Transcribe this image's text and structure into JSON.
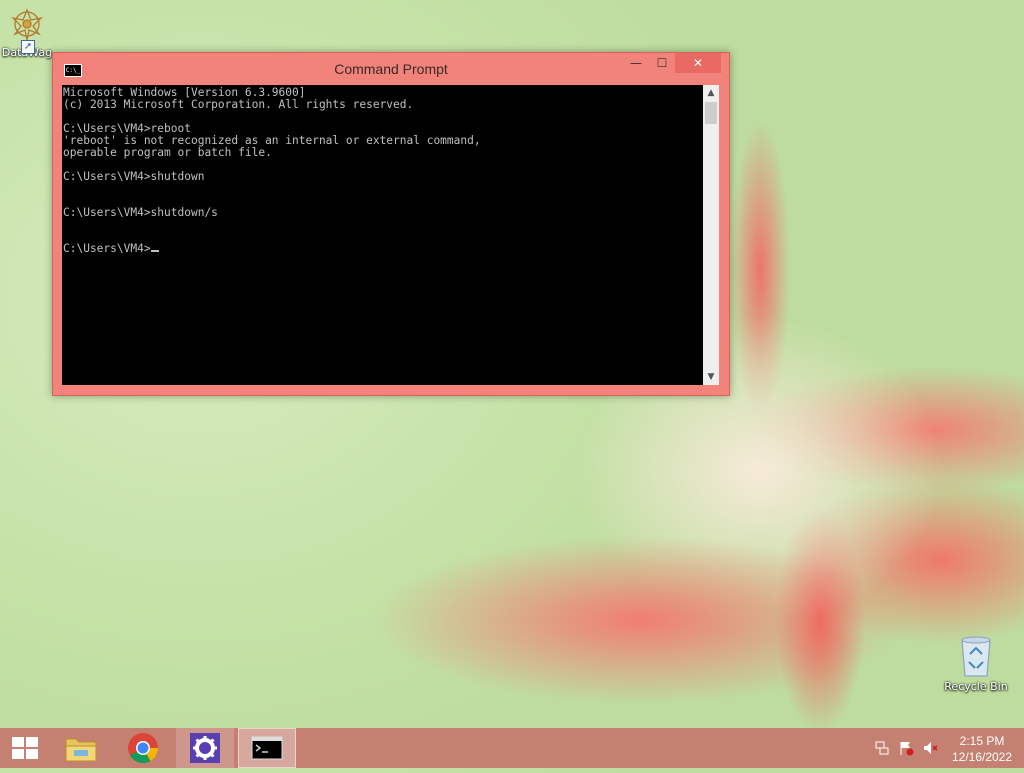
{
  "desktop": {
    "icons": [
      {
        "label": "DataWag"
      },
      {
        "label": "Recycle Bin"
      }
    ]
  },
  "window": {
    "title": "Command Prompt",
    "app_icon_text": "C:\\_",
    "controls": {
      "minimize": "—",
      "maximize": "☐",
      "close": "✕"
    },
    "console_lines": [
      "Microsoft Windows [Version 6.3.9600]",
      "(c) 2013 Microsoft Corporation. All rights reserved.",
      "",
      "C:\\Users\\VM4>reboot",
      "'reboot' is not recognized as an internal or external command,",
      "operable program or batch file.",
      "",
      "C:\\Users\\VM4>shutdown",
      "",
      "",
      "C:\\Users\\VM4>shutdown/s",
      "",
      "",
      "C:\\Users\\VM4>"
    ]
  },
  "taskbar": {
    "items": [
      {
        "name": "start",
        "icon": "windows-logo-icon"
      },
      {
        "name": "file-explorer",
        "icon": "folder-icon"
      },
      {
        "name": "chrome",
        "icon": "chrome-icon"
      },
      {
        "name": "settings",
        "icon": "gear-icon"
      },
      {
        "name": "command-prompt",
        "icon": "cmd-icon"
      }
    ],
    "tray": {
      "icons": [
        "network-icon",
        "action-center-flag-icon",
        "speaker-muted-icon"
      ]
    },
    "clock": {
      "time": "2:15 PM",
      "date": "12/16/2022"
    }
  },
  "colors": {
    "window_frame": "#f2837a",
    "taskbar": "#c4786e",
    "console_bg": "#000000",
    "console_fg": "#c0c0c0"
  }
}
